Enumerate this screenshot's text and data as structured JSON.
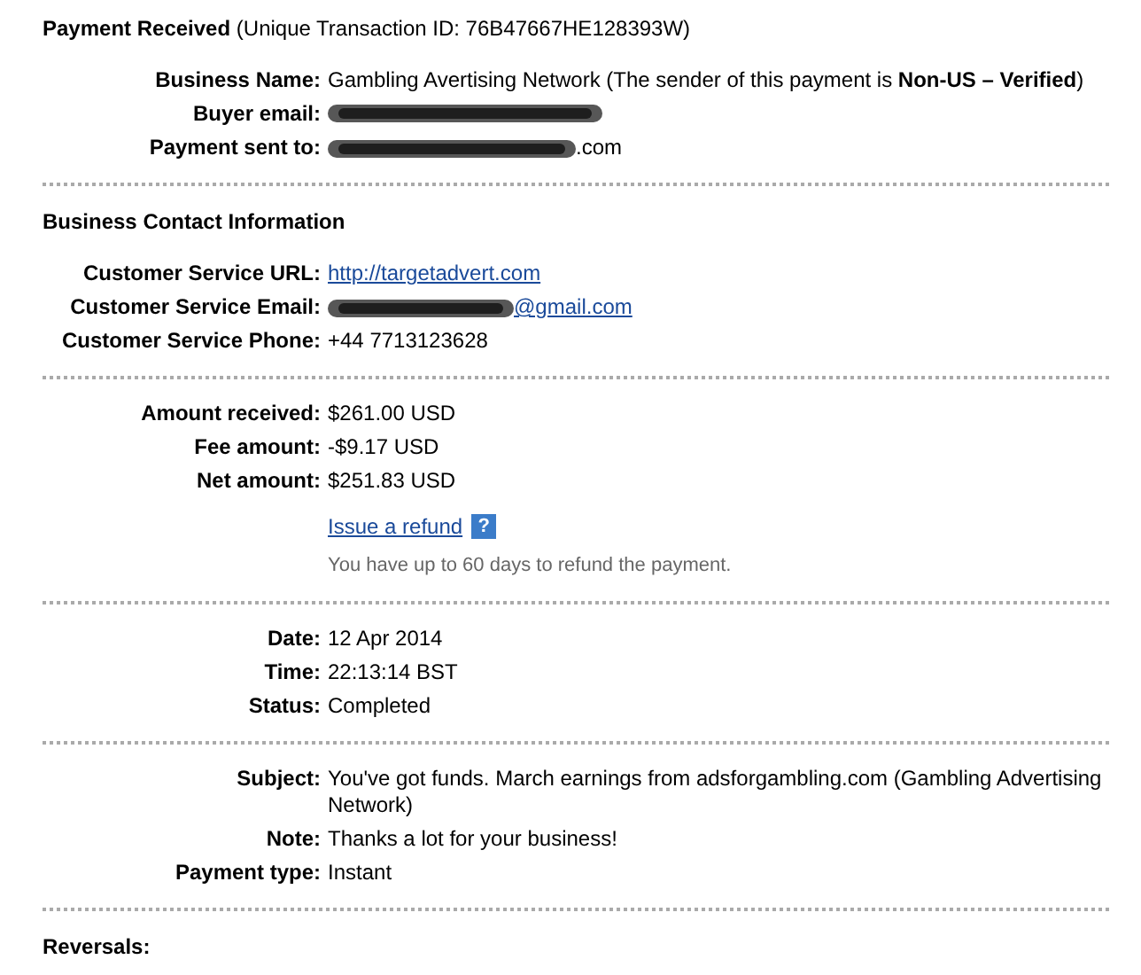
{
  "header": {
    "title": "Payment Received",
    "detail": "(Unique Transaction ID: 76B47667HE128393W)"
  },
  "sections": [
    {
      "rows": [
        {
          "label": "Business Name:",
          "kind": "text",
          "value": "Gambling Avertising Network (The sender of this payment is **Non-US – Verified**)"
        },
        {
          "label": "Buyer email:",
          "kind": "redacted"
        },
        {
          "label": "Payment sent to:",
          "kind": "redacted",
          "value": ".com"
        }
      ]
    },
    {
      "heading": "Business Contact Information",
      "rows": [
        {
          "label": "Customer Service URL:",
          "kind": "link",
          "value": "http://targetadvert.com"
        },
        {
          "label": "Customer Service Email:",
          "kind": "redacted_link",
          "value": "@gmail.com"
        },
        {
          "label": "Customer Service Phone:",
          "kind": "text",
          "value": "+44 7713123628"
        }
      ]
    },
    {
      "rows": [
        {
          "label": "Amount received:",
          "kind": "text",
          "value": "$261.00 USD"
        },
        {
          "label": "Fee amount:",
          "kind": "text",
          "value": "-$9.17 USD"
        },
        {
          "label": "Net amount:",
          "kind": "text",
          "value": "$251.83 USD"
        }
      ],
      "refund": {
        "link": "Issue a refund",
        "help": "?",
        "note": "You have up to 60 days to refund the payment."
      }
    },
    {
      "rows": [
        {
          "label": "Date:",
          "kind": "text",
          "value": "12 Apr 2014"
        },
        {
          "label": "Time:",
          "kind": "text",
          "value": "22:13:14 BST"
        },
        {
          "label": "Status:",
          "kind": "text",
          "value": "Completed"
        }
      ]
    },
    {
      "rows": [
        {
          "label": "Subject:",
          "kind": "text",
          "value": "You've got funds. March earnings from adsforgambling.com (Gambling Advertising Network)"
        },
        {
          "label": "Note:",
          "kind": "text",
          "value": "Thanks a lot for your business!"
        },
        {
          "label": "Payment type:",
          "kind": "text",
          "value": "Instant"
        }
      ]
    },
    {
      "heading": "Reversals:"
    }
  ]
}
